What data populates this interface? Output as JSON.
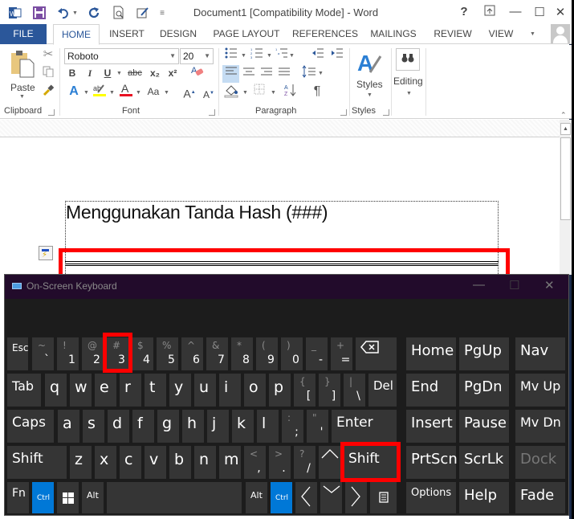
{
  "window": {
    "title": "Document1 [Compatibility Mode] - Word",
    "help": "?",
    "controls": {
      "ribbon_display": "ribbon-display-options-icon",
      "minimize": "—",
      "maximize": "☐",
      "close": "✕"
    }
  },
  "qat": {
    "icons": [
      "word-logo-icon",
      "save-icon",
      "undo-icon",
      "redo-icon",
      "print-preview-icon",
      "touch-mode-icon",
      "customize-qat-icon"
    ]
  },
  "tabs": [
    {
      "label": "FILE"
    },
    {
      "label": "HOME",
      "active": true
    },
    {
      "label": "INSERT"
    },
    {
      "label": "DESIGN"
    },
    {
      "label": "PAGE LAYOUT"
    },
    {
      "label": "REFERENCES"
    },
    {
      "label": "MAILINGS"
    },
    {
      "label": "REVIEW"
    },
    {
      "label": "VIEW"
    }
  ],
  "ribbon": {
    "clipboard": {
      "label": "Clipboard",
      "paste": "Paste"
    },
    "font": {
      "label": "Font",
      "font_name": "Roboto",
      "font_size": "20",
      "bold": "B",
      "italic": "I",
      "underline": "U",
      "strike": "abc",
      "subscript": "x₂",
      "superscript": "x²",
      "change_case": "Aa",
      "grow": "A",
      "shrink": "A",
      "highlight_color": "#ffff00",
      "font_color": "#e81123"
    },
    "paragraph": {
      "label": "Paragraph",
      "pilcrow": "¶"
    },
    "styles": {
      "label": "Styles",
      "button": "Styles"
    },
    "editing": {
      "button": "Editing"
    }
  },
  "document": {
    "heading": "Menggunakan Tanda Hash (###)"
  },
  "osk": {
    "title": "On-Screen Keyboard",
    "controls": {
      "minimize": "—",
      "restore": "☐",
      "close": "✕"
    },
    "row1": [
      {
        "label": "Esc"
      },
      {
        "shift": "~",
        "main": "`"
      },
      {
        "shift": "!",
        "main": "1"
      },
      {
        "shift": "@",
        "main": "2"
      },
      {
        "shift": "#",
        "main": "3"
      },
      {
        "shift": "$",
        "main": "4"
      },
      {
        "shift": "%",
        "main": "5"
      },
      {
        "shift": "^",
        "main": "6"
      },
      {
        "shift": "&",
        "main": "7"
      },
      {
        "shift": "*",
        "main": "8"
      },
      {
        "shift": "(",
        "main": "9"
      },
      {
        "shift": ")",
        "main": "0"
      },
      {
        "shift": "_",
        "main": "-"
      },
      {
        "shift": "+",
        "main": "="
      },
      {
        "label": "⌫"
      }
    ],
    "row2": [
      "Tab",
      "q",
      "w",
      "e",
      "r",
      "t",
      "y",
      "u",
      "i",
      "o",
      "p"
    ],
    "row2_sym": [
      {
        "shift": "{",
        "main": "["
      },
      {
        "shift": "}",
        "main": "]"
      },
      {
        "shift": "|",
        "main": "\\"
      }
    ],
    "row2_del": "Del",
    "row3": [
      "Caps",
      "a",
      "s",
      "d",
      "f",
      "g",
      "h",
      "j",
      "k",
      "l"
    ],
    "row3_sym": [
      {
        "shift": ":",
        "main": ";"
      },
      {
        "shift": "\"",
        "main": "'"
      }
    ],
    "row3_enter": "Enter",
    "row4": [
      "Shift",
      "z",
      "x",
      "c",
      "v",
      "b",
      "n",
      "m"
    ],
    "row4_sym": [
      {
        "shift": "<",
        "main": ","
      },
      {
        "shift": ">",
        "main": "."
      },
      {
        "shift": "?",
        "main": "/"
      }
    ],
    "row4_up": "^",
    "row4_shift": "Shift",
    "row5": {
      "fn": "Fn",
      "ctrl": "Ctrl",
      "alt": "Alt",
      "alt2": "Alt",
      "ctrl2": "Ctrl",
      "left": "<",
      "down": "v",
      "right": ">"
    },
    "nav": [
      [
        "Home",
        "PgUp",
        "Nav"
      ],
      [
        "End",
        "PgDn",
        "Mv Up"
      ],
      [
        "Insert",
        "Pause",
        "Mv Dn"
      ],
      [
        "PrtScn",
        "ScrLk",
        "Dock"
      ],
      [
        "Options",
        "Help",
        "Fade"
      ]
    ],
    "accent_blue": "#0078d7",
    "highlight_red": "#ff0000"
  }
}
